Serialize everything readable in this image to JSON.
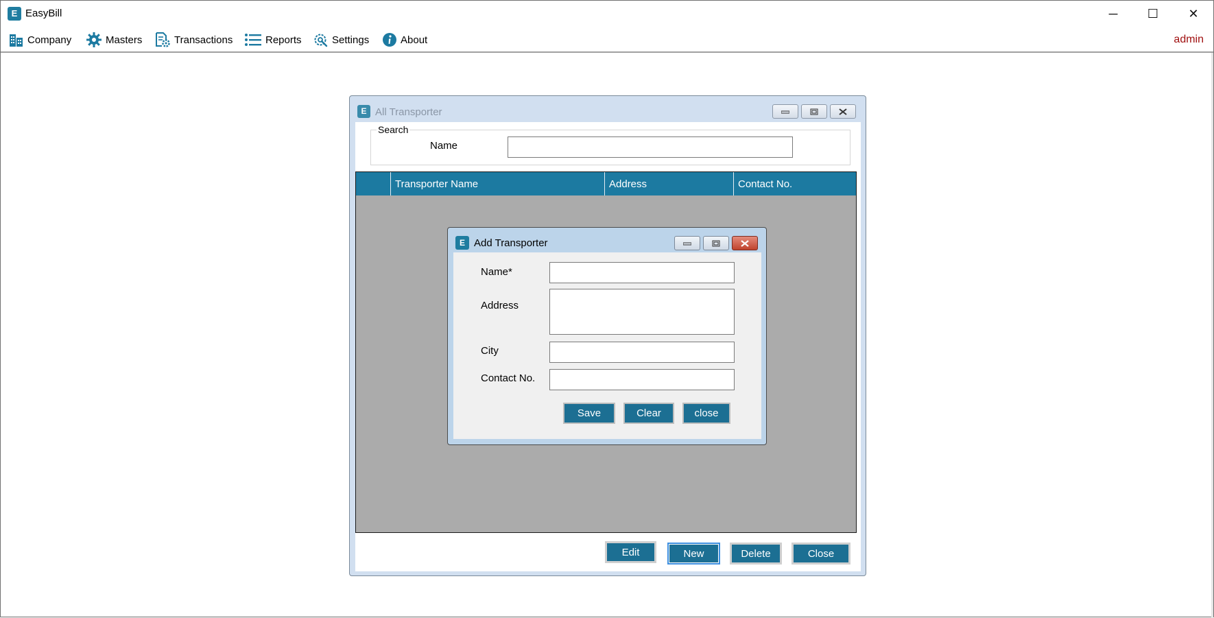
{
  "app": {
    "title": "EasyBill",
    "logo_letter": "E"
  },
  "window_controls": {
    "minimize": "─",
    "maximize": "☐",
    "close": "✕"
  },
  "menu": {
    "items": [
      {
        "label": "Company",
        "icon": "building-icon"
      },
      {
        "label": "Masters",
        "icon": "gear-icon"
      },
      {
        "label": "Transactions",
        "icon": "document-gear-icon"
      },
      {
        "label": "Reports",
        "icon": "list-icon"
      },
      {
        "label": "Settings",
        "icon": "wrench-gear-icon"
      },
      {
        "label": "About",
        "icon": "info-icon"
      }
    ],
    "user": "admin"
  },
  "all_transporter": {
    "title": "All Transporter",
    "logo_letter": "E",
    "search": {
      "legend": "Search",
      "name_label": "Name",
      "name_value": ""
    },
    "grid": {
      "columns": [
        "",
        "Transporter Name",
        "Address",
        "Contact No."
      ],
      "rows": []
    },
    "buttons": {
      "edit": "Edit",
      "new": "New",
      "delete": "Delete",
      "close": "Close"
    }
  },
  "add_transporter": {
    "title": "Add Transporter",
    "logo_letter": "E",
    "fields": {
      "name_label": "Name*",
      "address_label": "Address",
      "city_label": "City",
      "contact_label": "Contact No.",
      "name_value": "",
      "address_value": "",
      "city_value": "",
      "contact_value": ""
    },
    "buttons": {
      "save": "Save",
      "clear": "Clear",
      "close": "close"
    }
  },
  "colors": {
    "accent": "#1c7aa1",
    "button": "#1c6f93",
    "user_text": "#a01010",
    "grid_background": "#ababab"
  }
}
